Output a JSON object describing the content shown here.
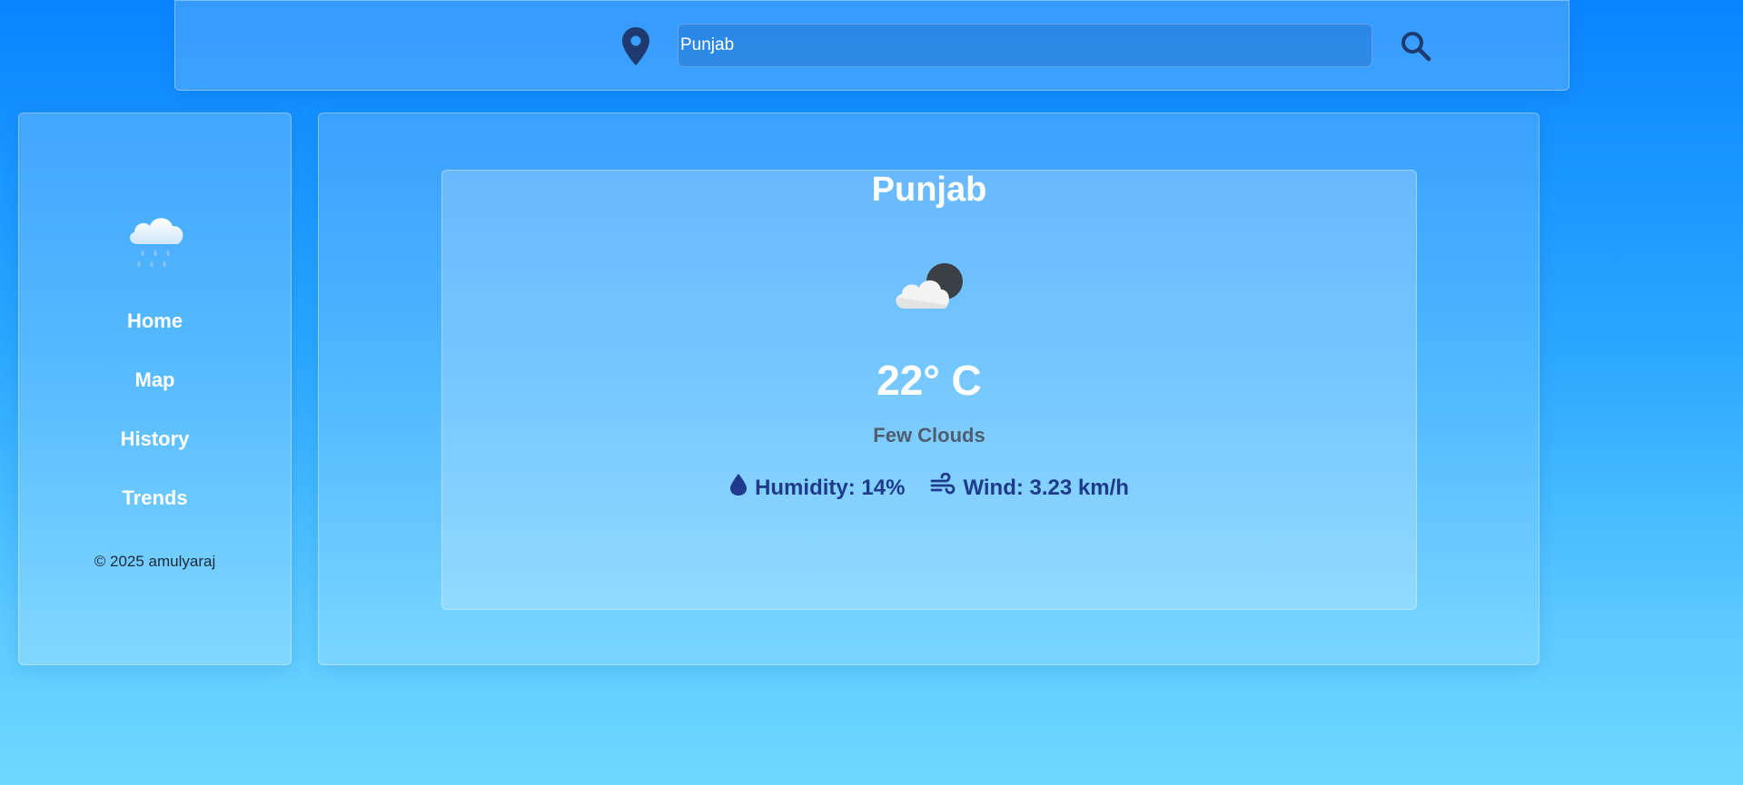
{
  "search": {
    "value": "Punjab",
    "location_icon": "map-pin-icon",
    "search_icon": "magnifier-icon"
  },
  "sidebar": {
    "logo_icon": "rain-cloud-icon",
    "items": [
      {
        "label": "Home"
      },
      {
        "label": "Map"
      },
      {
        "label": "History"
      },
      {
        "label": "Trends"
      }
    ],
    "copyright": "© 2025 amulyaraj"
  },
  "weather": {
    "city": "Punjab",
    "icon": "cloud-moon-icon",
    "temperature": "22° C",
    "description": "Few Clouds",
    "humidity_label": "Humidity: 14%",
    "wind_label": "Wind: 3.23 km/h"
  },
  "colors": {
    "background_top": "#0a84ff",
    "background_bottom": "#6fd8ff",
    "stat_text": "#1f3a8a",
    "pin_icon": "#1e3a6e"
  }
}
